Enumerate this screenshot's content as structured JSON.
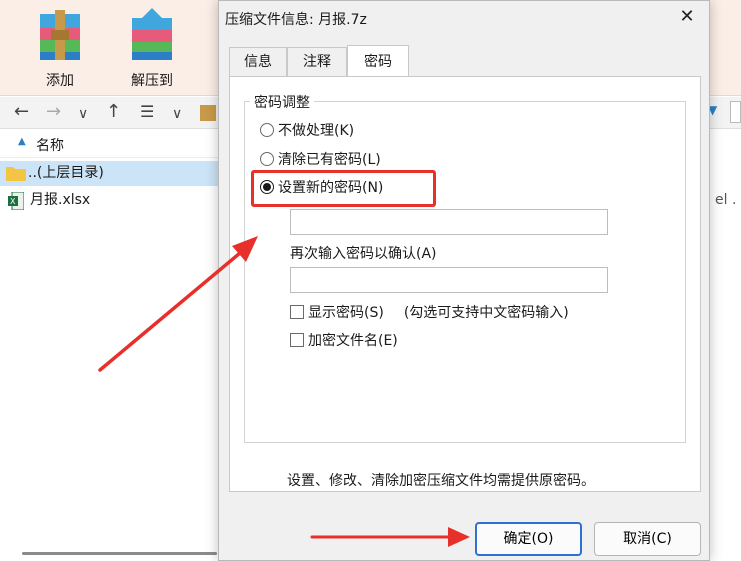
{
  "main": {
    "toolbar": [
      {
        "label": "添加",
        "icon": "winrar-add-icon"
      },
      {
        "label": "解压到",
        "icon": "winrar-extract-icon"
      }
    ],
    "column_header": "名称",
    "files": [
      {
        "name": "..(上层目录)",
        "icon": "folder-icon",
        "selected": true
      },
      {
        "name": "月报.xlsx",
        "icon": "excel-file-icon",
        "selected": false
      }
    ],
    "cut_text": "el ."
  },
  "dialog": {
    "title": "压缩文件信息: 月报.7z",
    "tabs": [
      {
        "label": "信息",
        "active": false
      },
      {
        "label": "注释",
        "active": false
      },
      {
        "label": "密码",
        "active": true
      }
    ],
    "group_title": "密码调整",
    "options": [
      {
        "label": "不做处理(K)",
        "checked": false
      },
      {
        "label": "清除已有密码(L)",
        "checked": false
      },
      {
        "label": "设置新的密码(N)",
        "checked": true
      }
    ],
    "password_value": "",
    "confirm_label": "再次输入密码以确认(A)",
    "confirm_value": "",
    "show_password_label": "显示密码(S)",
    "show_password_hint": "(勾选可支持中文密码输入)",
    "encrypt_names_label": "加密文件名(E)",
    "note": "设置、修改、清除加密压缩文件均需提供原密码。",
    "ok_label": "确定(O)",
    "cancel_label": "取消(C)"
  },
  "colors": {
    "annotation_red": "#e8302b",
    "toolbar_bg": "#fbeee6",
    "selection": "#cce4f7",
    "primary_border": "#2f6fd6"
  }
}
